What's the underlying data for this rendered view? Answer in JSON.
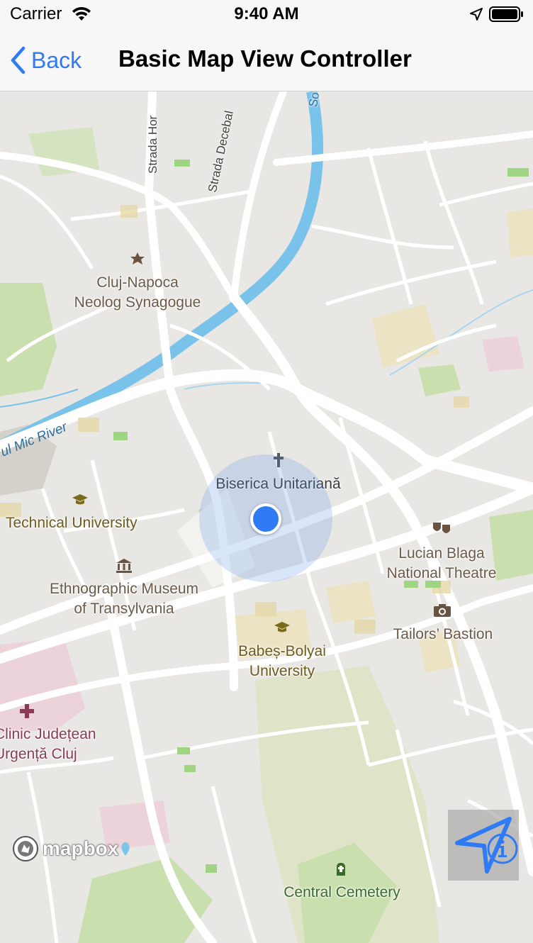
{
  "status_bar": {
    "carrier": "Carrier",
    "time": "9:40 AM"
  },
  "nav": {
    "back_label": "Back",
    "title": "Basic Map View Controller"
  },
  "map": {
    "streets": {
      "strada_hor": "Strada Hor",
      "strada_decebal": "Strada Decebal",
      "river": "ul Mic River",
      "top_river_fragment": "So"
    },
    "pois": {
      "synagogue": "Cluj-Napoca\nNeolog Synagogue",
      "church": "Biserica Unitariană",
      "technical_university": "Technical University",
      "museum": "Ethnographic Museum\nof Transylvania",
      "theatre": "Lucian Blaga\nNational Theatre",
      "bastion": "Tailors’ Bastion",
      "babes_bolyai": "Babeș-Bolyai\nUniversity",
      "hospital": "Clinic Județean\nUrgență Cluj",
      "cemetery": "Central Cemetery"
    },
    "attribution": {
      "logo_text": "mapbox"
    }
  },
  "colors": {
    "accent": "#2f7bf5",
    "water": "#79c2ea",
    "park": "#c9dfae",
    "land": "#e9e7e4",
    "road": "#ffffff"
  },
  "icons": {
    "wifi": "wifi-icon",
    "location_arrow": "location-arrow-icon",
    "battery": "battery-icon",
    "back": "chevron-left-icon",
    "locate": "navigation-arrow-icon",
    "info": "info-circle-icon"
  }
}
